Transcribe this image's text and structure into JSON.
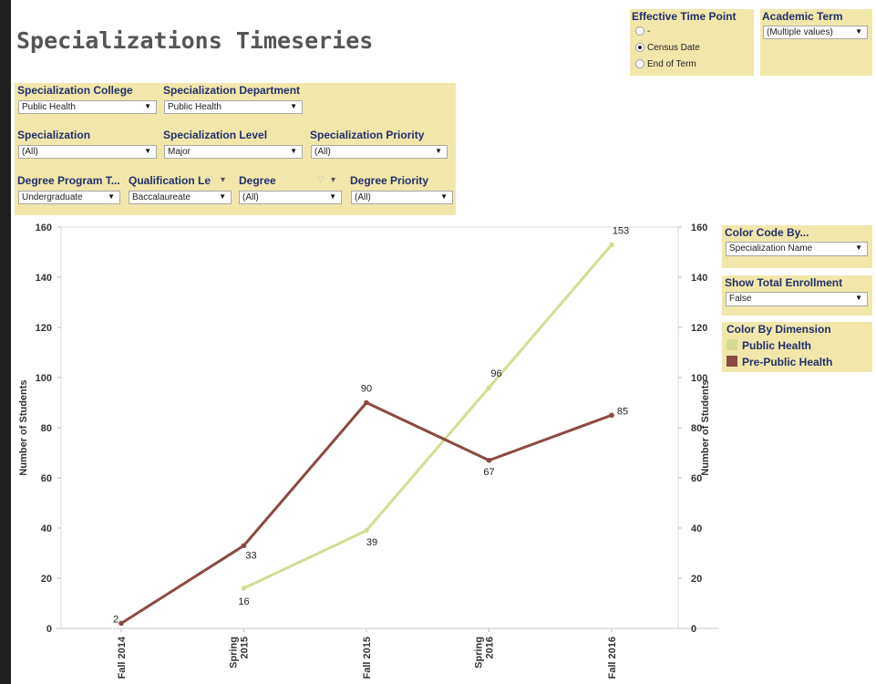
{
  "page_title": "Specializations Timeseries",
  "filters": {
    "specialization_college": {
      "label": "Specialization College",
      "value": "Public Health"
    },
    "specialization_department": {
      "label": "Specialization Department",
      "value": "Public Health"
    },
    "specialization": {
      "label": "Specialization",
      "value": "(All)"
    },
    "specialization_level": {
      "label": "Specialization Level",
      "value": "Major"
    },
    "specialization_priority": {
      "label": "Specialization Priority",
      "value": "(All)"
    },
    "degree_program_type": {
      "label": "Degree Program T...",
      "value": "Undergraduate"
    },
    "qualification_level": {
      "label": "Qualification Le",
      "value": "Baccalaureate"
    },
    "degree": {
      "label": "Degree",
      "value": "(All)"
    },
    "degree_priority": {
      "label": "Degree Priority",
      "value": "(All)"
    }
  },
  "effective_time_point": {
    "label": "Effective Time Point",
    "options": [
      "-",
      "Census Date",
      "End of Term"
    ],
    "selected": "Census Date"
  },
  "academic_term": {
    "label": "Academic Term",
    "value": "(Multiple values)"
  },
  "color_code_by": {
    "label": "Color Code By...",
    "value": "Specialization Name"
  },
  "show_total_enrollment": {
    "label": "Show Total Enrollment",
    "value": "False"
  },
  "legend": {
    "title": "Color By Dimension",
    "items": [
      {
        "label": "Public Health",
        "color": "#d5dc92"
      },
      {
        "label": "Pre-Public Health",
        "color": "#8b4a42"
      }
    ]
  },
  "chart_data": {
    "type": "line",
    "ylabel": "Number of Students",
    "ylabel_right": "Number of Students",
    "ylim": [
      0,
      160
    ],
    "yticks": [
      0,
      20,
      40,
      60,
      80,
      100,
      120,
      140,
      160
    ],
    "categories": [
      "Fall 2014",
      "Spring 2015",
      "Fall 2015",
      "Spring 2016",
      "Fall 2016"
    ],
    "category_lines": [
      [
        "Fall 2014"
      ],
      [
        "Spring",
        "2015"
      ],
      [
        "Fall 2015"
      ],
      [
        "Spring",
        "2016"
      ],
      [
        "Fall 2016"
      ]
    ],
    "grid": false,
    "series": [
      {
        "name": "Public Health",
        "color": "#d5dc92",
        "values": [
          null,
          16,
          39,
          96,
          153
        ]
      },
      {
        "name": "Pre-Public Health",
        "color": "#8b4a42",
        "values": [
          2,
          33,
          90,
          67,
          85
        ]
      }
    ]
  }
}
